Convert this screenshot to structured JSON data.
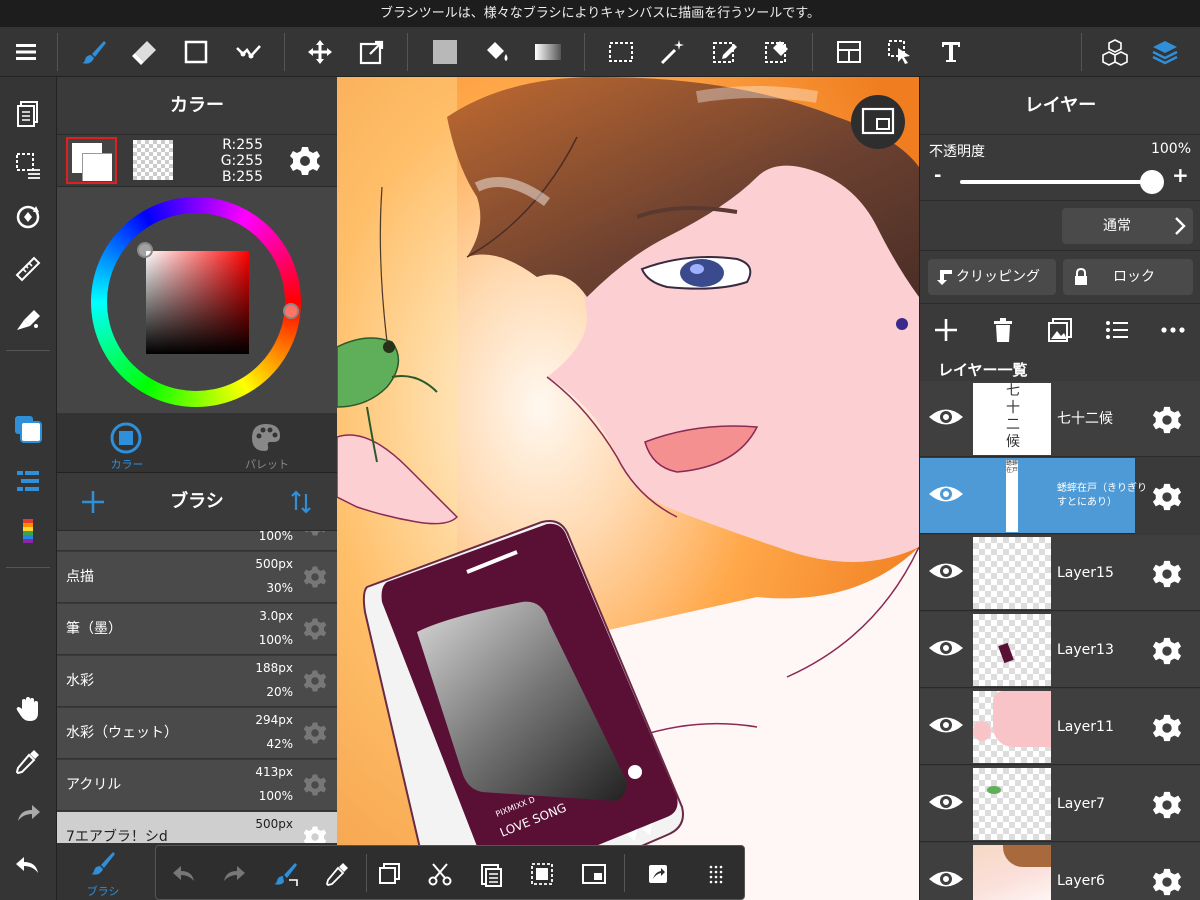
{
  "hint": "ブラシツールは、様々なブラシによりキャンバスに描画を行うツールです。",
  "color_panel": {
    "title": "カラー",
    "rgb": {
      "r": "R:255",
      "g": "G:255",
      "b": "B:255"
    },
    "tabs": [
      {
        "label": "カラー"
      },
      {
        "label": "パレット"
      }
    ],
    "accent": "#2f8fd8"
  },
  "brush_panel": {
    "title": "ブラシ",
    "items": [
      {
        "name": "",
        "size": "",
        "opacity": "100%"
      },
      {
        "name": "点描",
        "size": "500px",
        "opacity": "30%"
      },
      {
        "name": "筆（墨）",
        "size": "3.0px",
        "opacity": "100%"
      },
      {
        "name": "水彩",
        "size": "188px",
        "opacity": "20%"
      },
      {
        "name": "水彩（ウェット）",
        "size": "294px",
        "opacity": "42%"
      },
      {
        "name": "アクリル",
        "size": "413px",
        "opacity": "100%"
      },
      {
        "name": "7エアブラ！シd",
        "size": "500px",
        "opacity": ""
      }
    ],
    "footer_label": "ブラシ"
  },
  "layer_panel": {
    "title": "レイヤー",
    "opacity_label": "不透明度",
    "opacity_value": "100%",
    "opacity": 1.0,
    "minus": "-",
    "plus": "+",
    "blend_mode": "通常",
    "clipping": "クリッピング",
    "lock": "ロック",
    "list_title": "レイヤー一覧",
    "layers": [
      {
        "name": "七十二候",
        "selected": false
      },
      {
        "name": "蟋蟀在戸（きりぎりすとにあり）",
        "selected": true
      },
      {
        "name": "Layer15",
        "selected": false
      },
      {
        "name": "Layer13",
        "selected": false
      },
      {
        "name": "Layer11",
        "selected": false
      },
      {
        "name": "Layer7",
        "selected": false
      },
      {
        "name": "Layer6",
        "selected": false
      }
    ],
    "thumb_text_1": "七十二候",
    "thumb_text_2": "蟋蟀在戸",
    "accent": "#4d9ad6"
  },
  "canvas": {
    "phone_text_1": "LOVE SONG",
    "phone_text_2": "PIXMIXX D"
  },
  "icons": {
    "toolbar": [
      "menu-icon",
      "brush-icon",
      "eraser-icon",
      "rectangle-icon",
      "dot-icon",
      "move-icon",
      "transform-icon",
      "fill-color-icon",
      "bucket-icon",
      "gradient-icon",
      "select-icon",
      "magic-wand-icon",
      "select-pen-icon",
      "select-eraser-icon",
      "panel-layout-icon",
      "selection-move-icon",
      "text-icon",
      "material-icon",
      "layers-icon"
    ],
    "bottom": [
      "undo-icon",
      "redo-icon",
      "brush-sync-icon",
      "eyedropper-icon",
      "copy-icon",
      "cut-icon",
      "paste-icon",
      "fill-select-icon",
      "window-icon",
      "export-icon",
      "grid-icon"
    ]
  }
}
